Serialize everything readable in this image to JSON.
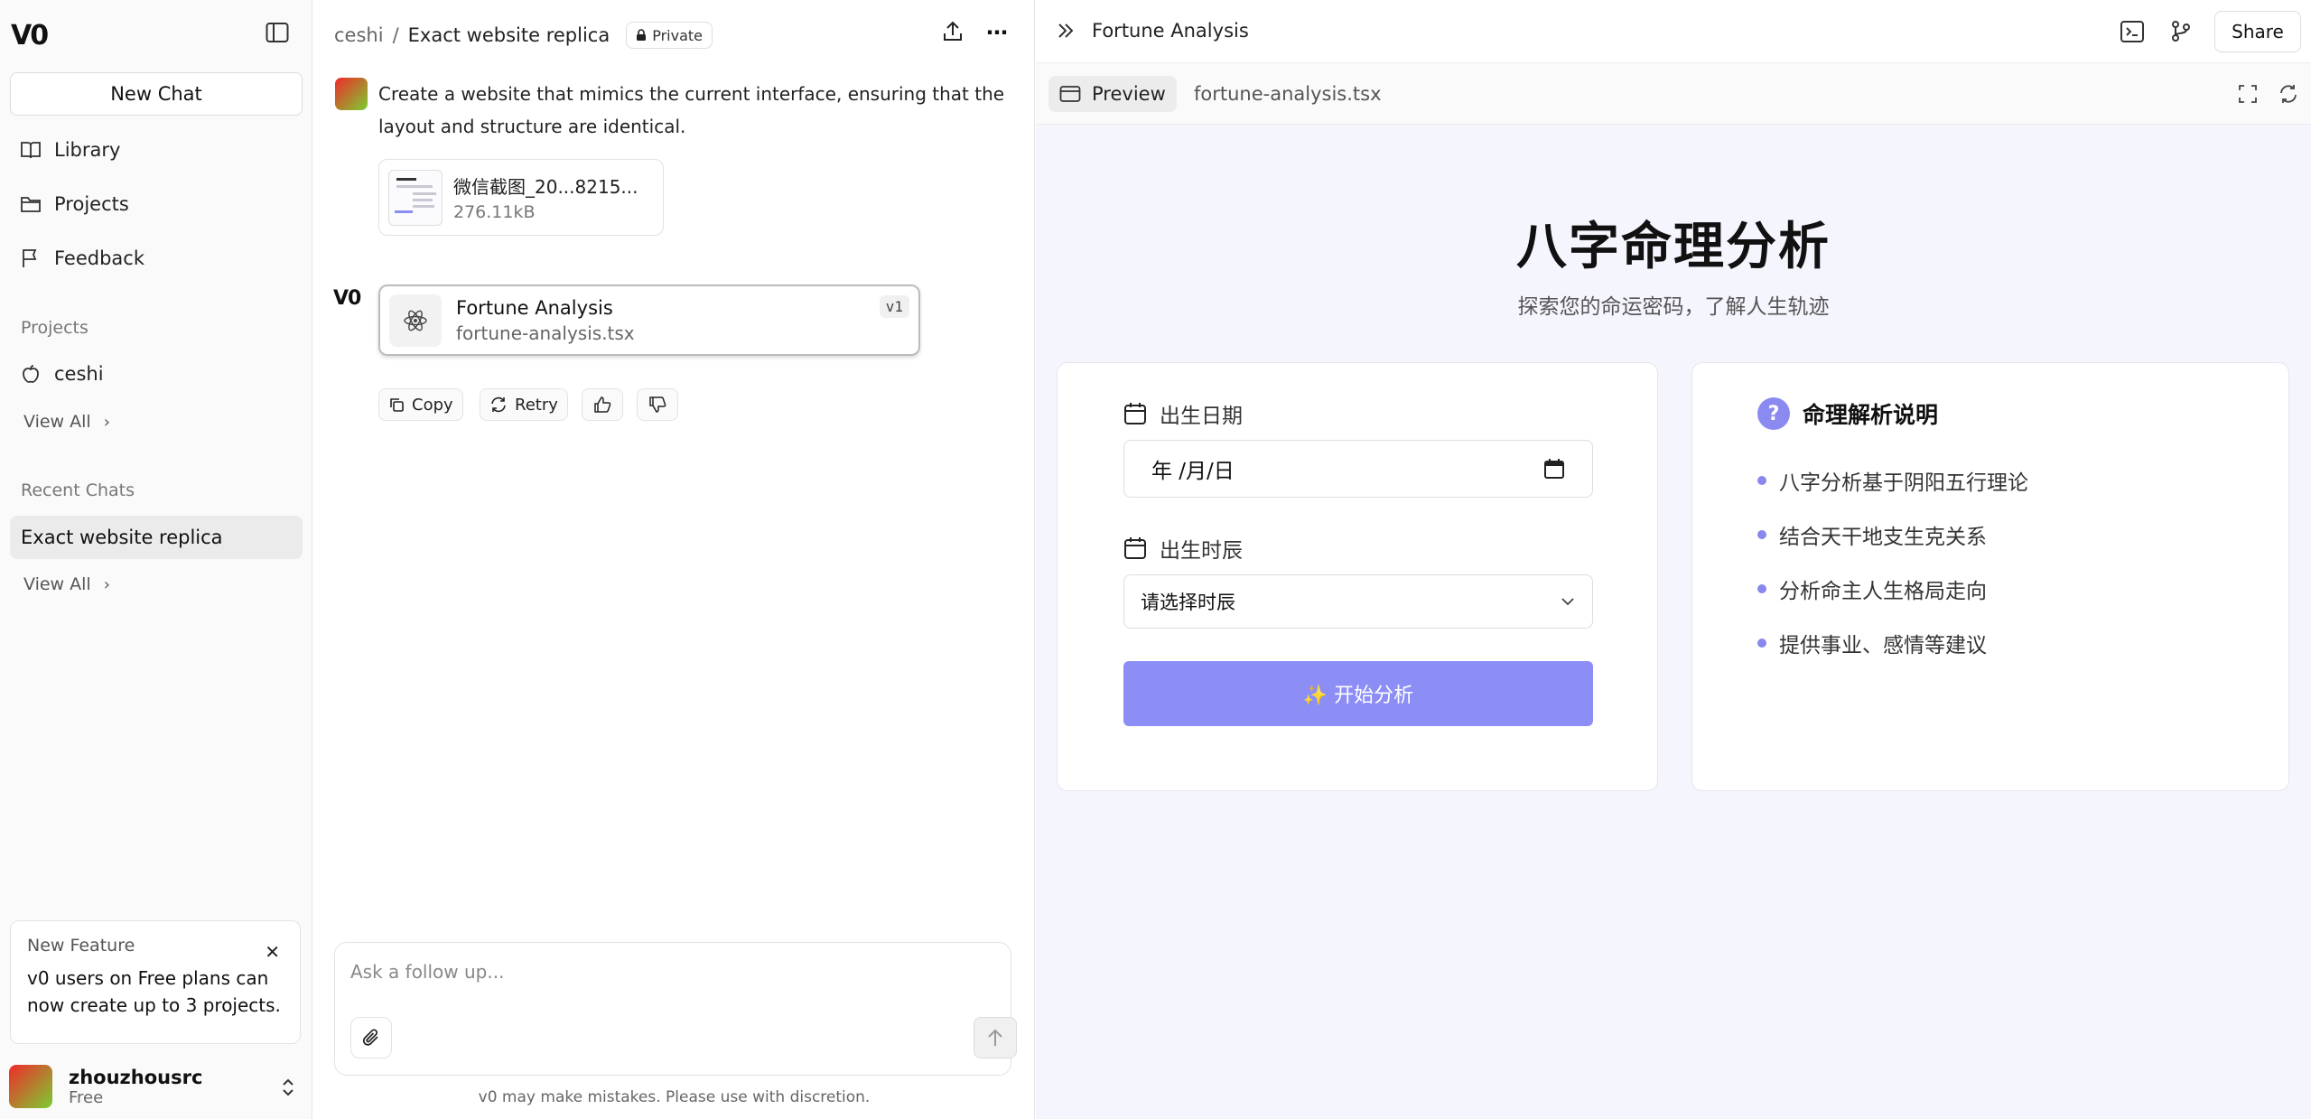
{
  "sidebar": {
    "logo": "V0",
    "new_chat": "New Chat",
    "nav": [
      {
        "label": "Library",
        "icon": "book-icon"
      },
      {
        "label": "Projects",
        "icon": "folder-icon"
      },
      {
        "label": "Feedback",
        "icon": "flag-icon"
      }
    ],
    "projects_label": "Projects",
    "project_item": "ceshi",
    "view_all": "View All",
    "recent_label": "Recent Chats",
    "recent_item": "Exact website replica",
    "feature": {
      "title": "New Feature",
      "body": "v0 users on Free plans can now create up to 3 projects."
    },
    "user": {
      "name": "zhouzhousrc",
      "plan": "Free"
    }
  },
  "chat": {
    "breadcrumb_project": "ceshi",
    "breadcrumb_sep": "/",
    "breadcrumb_chat": "Exact website replica",
    "privacy": "Private",
    "user_message": "Create a website that mimics the current interface, ensuring that the layout and structure are identical.",
    "attachment": {
      "name": "微信截图_20...8215...",
      "size": "276.11kB"
    },
    "block": {
      "title": "Fortune Analysis",
      "file": "fortune-analysis.tsx",
      "version": "v1"
    },
    "actions": {
      "copy": "Copy",
      "retry": "Retry"
    },
    "composer_placeholder": "Ask a follow up...",
    "disclaimer": "v0 may make mistakes. Please use with discretion."
  },
  "panel": {
    "title": "Fortune Analysis",
    "share": "Share",
    "tab_preview": "Preview",
    "tab_file": "fortune-analysis.tsx"
  },
  "app": {
    "title": "八字命理分析",
    "subtitle": "探索您的命运密码，了解人生轨迹",
    "birth_date_label": "出生日期",
    "birth_date_value": "年 /月/日",
    "birth_hour_label": "出生时辰",
    "birth_hour_placeholder": "请选择时辰",
    "submit": "✨ 开始分析",
    "info_title": "命理解析说明",
    "info_items": [
      "八字分析基于阴阳五行理论",
      "结合天干地支生克关系",
      "分析命主人生格局走向",
      "提供事业、感情等建议"
    ]
  }
}
